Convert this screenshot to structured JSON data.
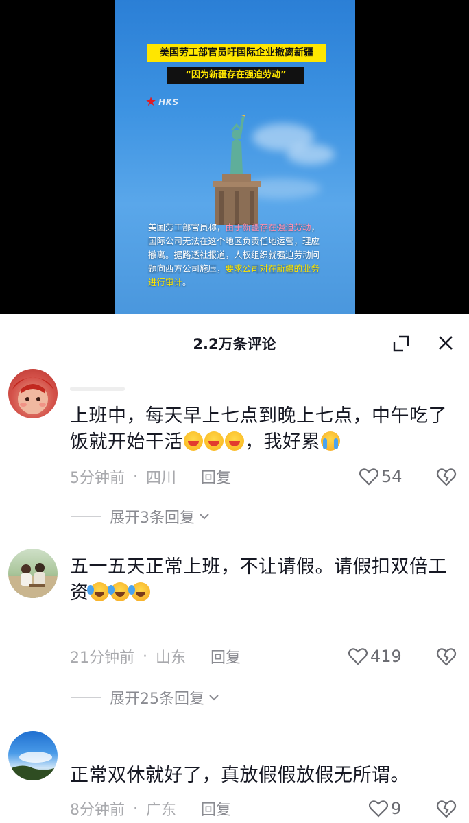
{
  "video": {
    "headline_1": "美国劳工部官员吁国际企业撤离新疆",
    "headline_2": "“因为新疆存在强迫劳动”",
    "logo_text": "HKS",
    "caption_parts": [
      {
        "text": "美国劳工部官员称，",
        "style": "plain"
      },
      {
        "text": "由于新疆存在强迫劳动",
        "style": "pink"
      },
      {
        "text": "，国际公司无法在这个地区负责任地运营，理应撤离。据路透社报道，人权组织就强迫劳动问题向西方公司施压，",
        "style": "plain"
      },
      {
        "text": "要求公司对在新疆的业务进行审计",
        "style": "yellow"
      },
      {
        "text": "。",
        "style": "plain"
      }
    ]
  },
  "panel": {
    "title": "2.2万条评论"
  },
  "comments": [
    {
      "text": "上班中，每天早上七点到晚上七点，中午吃了饭就开始干活",
      "text_after": "，我好累",
      "time": "5分钟前",
      "location": "四川",
      "reply_label": "回复",
      "likes": "54",
      "replies_label": "展开3条回复"
    },
    {
      "text": "五一五天正常上班，不让请假。请假扣双倍工资",
      "time": "21分钟前",
      "location": "山东",
      "reply_label": "回复",
      "likes": "419",
      "replies_label": "展开25条回复"
    },
    {
      "text": "正常双休就好了，真放假假放假无所谓。",
      "time": "8分钟前",
      "location": "广东",
      "reply_label": "回复",
      "likes": "9"
    }
  ],
  "separator": "·",
  "colors": {
    "headline_bg": "#ffe600",
    "caption_pink": "#ff8fb0",
    "meta_gray": "#a8a9ad",
    "text_dark": "#161823"
  },
  "icons": [
    "expand-icon",
    "close-icon",
    "heart-icon",
    "broken-heart-icon",
    "chevron-down-icon",
    "star-icon"
  ]
}
